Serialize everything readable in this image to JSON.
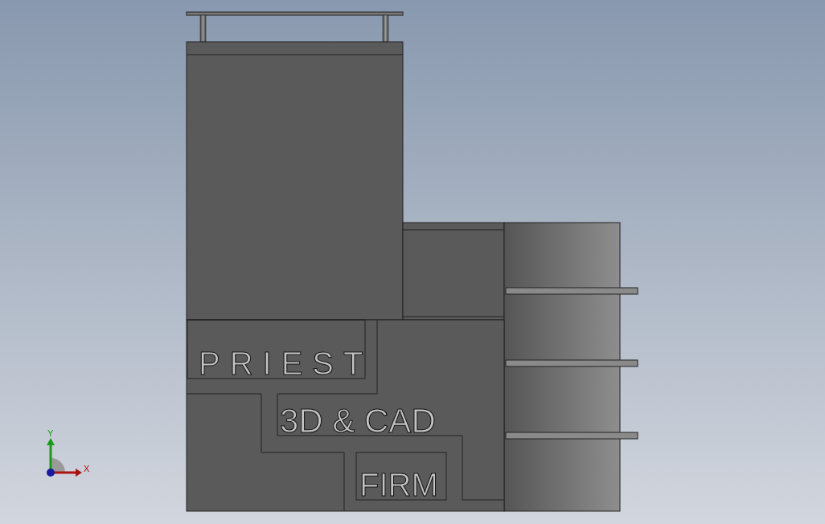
{
  "model": {
    "engravings": [
      "PRIEST",
      "3D & CAD",
      "FIRM"
    ]
  },
  "triad": {
    "x_label": "X",
    "y_label": "Y"
  }
}
